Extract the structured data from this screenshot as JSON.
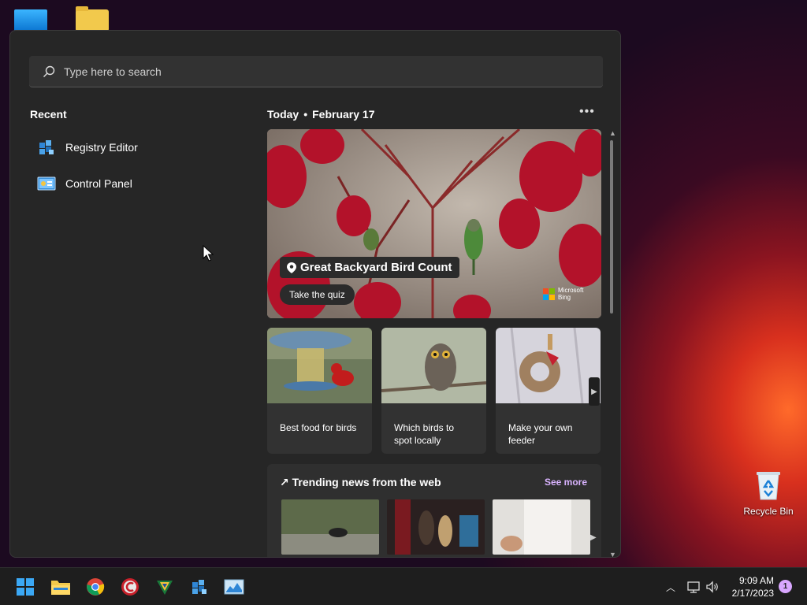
{
  "search": {
    "placeholder": "Type here to search"
  },
  "recent": {
    "title": "Recent",
    "items": [
      {
        "label": "Registry Editor",
        "icon": "registry-editor-icon"
      },
      {
        "label": "Control Panel",
        "icon": "control-panel-icon"
      }
    ]
  },
  "today": {
    "label": "Today",
    "date": "February 17"
  },
  "hero": {
    "title": "Great Backyard Bird Count",
    "cta": "Take the quiz",
    "brand_line1": "Microsoft",
    "brand_line2": "Bing"
  },
  "cards": [
    {
      "caption": "Best food for birds"
    },
    {
      "caption": "Which birds to spot locally"
    },
    {
      "caption": "Make your own feeder"
    }
  ],
  "trending": {
    "title": "Trending news from the web",
    "see_more": "See more"
  },
  "desktop": {
    "recycle_bin": "Recycle Bin"
  },
  "taskbar": {
    "time": "9:09 AM",
    "date": "2/17/2023",
    "notifications": "1"
  },
  "colors": {
    "accent": "#d9b3ff",
    "panel": "#262626",
    "card": "#323232"
  }
}
